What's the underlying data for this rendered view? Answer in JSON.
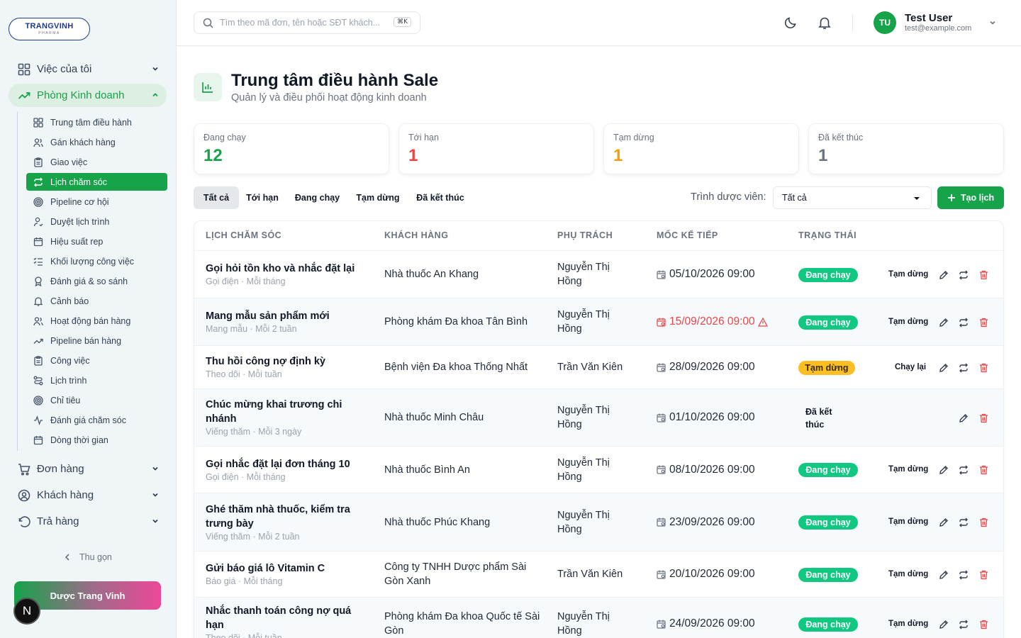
{
  "brand": {
    "logo_text": "TRANGVINH",
    "logo_sub": "PHARMA",
    "footer_name": "Dược Trang Vinh",
    "n_avatar": "N"
  },
  "sidebar": {
    "groups": [
      {
        "label": "Việc của tôi",
        "icon": "grid-icon"
      },
      {
        "label": "Phòng Kinh doanh",
        "icon": "trend-icon"
      },
      {
        "label": "Đơn hàng",
        "icon": "cart-icon"
      },
      {
        "label": "Khách hàng",
        "icon": "user-circle-icon"
      },
      {
        "label": "Trả hàng",
        "icon": "undo-icon"
      }
    ],
    "items": [
      {
        "label": "Trung tâm điều hành",
        "icon": "grid-icon"
      },
      {
        "label": "Gán khách hàng",
        "icon": "users-icon"
      },
      {
        "label": "Giao việc",
        "icon": "clipboard-icon"
      },
      {
        "label": "Lịch chăm sóc",
        "icon": "repeat-icon"
      },
      {
        "label": "Pipeline cơ hội",
        "icon": "target-icon"
      },
      {
        "label": "Duyệt lịch trình",
        "icon": "user-check-icon"
      },
      {
        "label": "Hiệu suất rep",
        "icon": "calendar-icon"
      },
      {
        "label": "Khối lượng công việc",
        "icon": "list-check-icon"
      },
      {
        "label": "Đánh giá & so sánh",
        "icon": "award-icon"
      },
      {
        "label": "Cảnh báo",
        "icon": "bell-icon"
      },
      {
        "label": "Hoạt động bán hàng",
        "icon": "users-icon"
      },
      {
        "label": "Pipeline bán hàng",
        "icon": "trend-icon"
      },
      {
        "label": "Công việc",
        "icon": "clipboard-icon"
      },
      {
        "label": "Lịch trình",
        "icon": "route-icon"
      },
      {
        "label": "Chỉ tiêu",
        "icon": "target-icon"
      },
      {
        "label": "Đánh giá chăm sóc",
        "icon": "activity-icon"
      },
      {
        "label": "Dòng thời gian",
        "icon": "calendar-icon"
      }
    ],
    "collapse_label": "Thu gọn"
  },
  "topbar": {
    "search_placeholder": "Tìm theo mã đơn, tên hoặc SĐT khách...",
    "shortcut": "⌘K",
    "user_initials": "TU",
    "user_name": "Test User",
    "user_email": "test@example.com"
  },
  "page": {
    "title": "Trung tâm điều hành Sale",
    "subtitle": "Quản lý và điều phối hoạt động kinh doanh"
  },
  "stats": [
    {
      "label": "Đang chạy",
      "value": "12",
      "color": "#16a34a"
    },
    {
      "label": "Tới hạn",
      "value": "1",
      "color": "#ef4444"
    },
    {
      "label": "Tạm dừng",
      "value": "1",
      "color": "#f59e0b"
    },
    {
      "label": "Đã kết thúc",
      "value": "1",
      "color": "#6b7280"
    }
  ],
  "tabs": [
    "Tất cả",
    "Tới hạn",
    "Đang chạy",
    "Tạm dừng",
    "Đã kết thúc"
  ],
  "filter": {
    "label": "Trình dược viên:",
    "value": "Tất cả"
  },
  "create_label": "Tạo lịch",
  "table": {
    "headers": [
      "LỊCH CHĂM SÓC",
      "KHÁCH HÀNG",
      "PHỤ TRÁCH",
      "MỐC KẾ TIẾP",
      "TRẠNG THÁI"
    ],
    "rows": [
      {
        "title": "Gọi hỏi tồn kho và nhắc đặt lại",
        "sub": "Gọi điện · Mỗi tháng",
        "customer": "Nhà thuốc An Khang",
        "owner": "Nguyễn Thị Hồng",
        "date": "05/10/2026 09:00",
        "overdue": false,
        "status": "Đang chạy",
        "action": "Tạm dừng"
      },
      {
        "title": "Mang mẫu sản phẩm mới",
        "sub": "Mang mẫu · Mỗi 2 tuần",
        "customer": "Phòng khám Đa khoa Tân Bình",
        "owner": "Nguyễn Thị Hồng",
        "date": "15/09/2026 09:00",
        "overdue": true,
        "status": "Đang chạy",
        "action": "Tạm dừng"
      },
      {
        "title": "Thu hồi công nợ định kỳ",
        "sub": "Theo dõi · Mỗi tuần",
        "customer": "Bệnh viện Đa khoa Thống Nhất",
        "owner": "Trần Văn Kiên",
        "date": "28/09/2026 09:00",
        "overdue": false,
        "status": "Tạm dừng",
        "action": "Chạy lại"
      },
      {
        "title": "Chúc mừng khai trương chi nhánh",
        "sub": "Viếng thăm · Mỗi 3 ngày",
        "customer": "Nhà thuốc Minh Châu",
        "owner": "Nguyễn Thị Hồng",
        "date": "01/10/2026 09:00",
        "overdue": false,
        "status": "Đã kết thúc",
        "action": ""
      },
      {
        "title": "Gọi nhắc đặt lại đơn tháng 10",
        "sub": "Gọi điện · Mỗi tháng",
        "customer": "Nhà thuốc Bình An",
        "owner": "Nguyễn Thị Hồng",
        "date": "08/10/2026 09:00",
        "overdue": false,
        "status": "Đang chạy",
        "action": "Tạm dừng"
      },
      {
        "title": "Ghé thăm nhà thuốc, kiểm tra trưng bày",
        "sub": "Viếng thăm · Mỗi 2 tuần",
        "customer": "Nhà thuốc Phúc Khang",
        "owner": "Nguyễn Thị Hồng",
        "date": "23/09/2026 09:00",
        "overdue": false,
        "status": "Đang chạy",
        "action": "Tạm dừng"
      },
      {
        "title": "Gửi báo giá lô Vitamin C",
        "sub": "Báo giá · Mỗi tháng",
        "customer": "Công ty TNHH Dược phẩm Sài Gòn Xanh",
        "owner": "Trần Văn Kiên",
        "date": "20/10/2026 09:00",
        "overdue": false,
        "status": "Đang chạy",
        "action": "Tạm dừng"
      },
      {
        "title": "Nhắc thanh toán công nợ quá hạn",
        "sub": "Theo dõi · Mỗi tuần",
        "customer": "Phòng khám Đa khoa Quốc tế Sài Gòn",
        "owner": "Nguyễn Thị Hồng",
        "date": "24/09/2026 09:00",
        "overdue": false,
        "status": "Đang chạy",
        "action": "Tạm dừng"
      }
    ]
  }
}
